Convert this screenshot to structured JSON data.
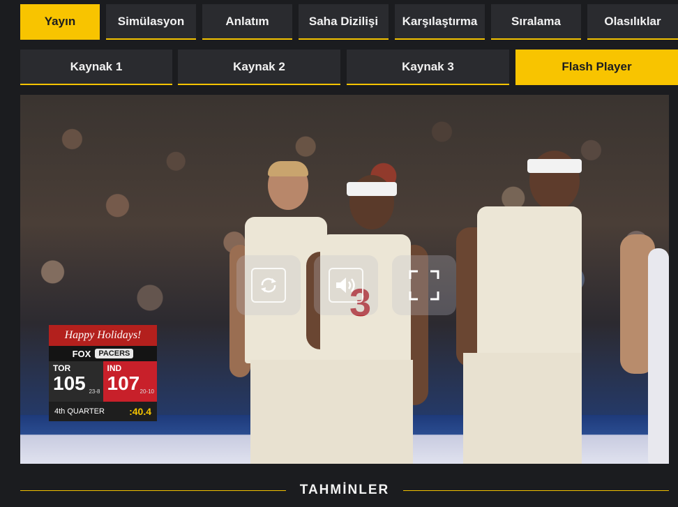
{
  "tabs_top": [
    {
      "label": "Yayın",
      "active": true
    },
    {
      "label": "Simülasyon",
      "active": false
    },
    {
      "label": "Anlatım",
      "active": false
    },
    {
      "label": "Saha Dizilişi",
      "active": false
    },
    {
      "label": "Karşılaştırma",
      "active": false
    },
    {
      "label": "Sıralama",
      "active": false
    },
    {
      "label": "Olasılıklar",
      "active": false
    }
  ],
  "tabs_source": [
    {
      "label": "Kaynak 1",
      "active": false
    },
    {
      "label": "Kaynak 2",
      "active": false
    },
    {
      "label": "Kaynak 3",
      "active": false
    },
    {
      "label": "Flash Player",
      "active": true
    }
  ],
  "player": {
    "controls": [
      {
        "icon": "replay-icon"
      },
      {
        "icon": "volume-icon"
      },
      {
        "icon": "fullscreen-icon"
      }
    ],
    "scorebug": {
      "banner": "Happy Holidays!",
      "network": "FOX",
      "network_partner": "PACERS",
      "home": {
        "abbr": "TOR",
        "score": "105",
        "record": "23-8"
      },
      "away": {
        "abbr": "IND",
        "score": "107",
        "record": "20-10"
      },
      "period": "4th QUARTER",
      "clock": ":40.4"
    },
    "jersey_number": "3"
  },
  "section": {
    "title": "TAHMİNLER"
  },
  "colors": {
    "accent": "#f8c400",
    "tab_bg": "#2a2b2f",
    "page_bg": "#1b1c1f"
  }
}
